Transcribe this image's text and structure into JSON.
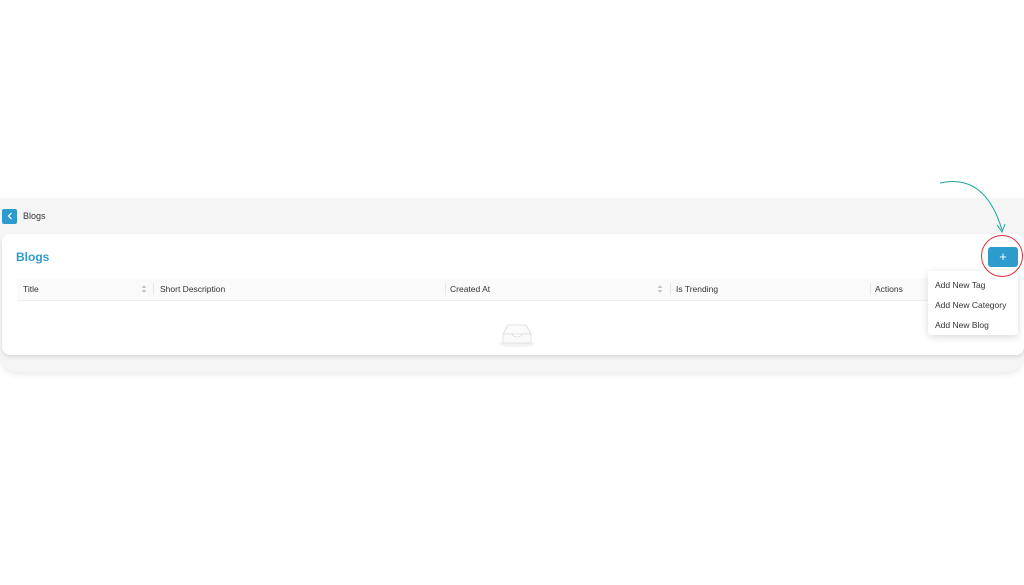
{
  "topbar": {
    "breadcrumb": "Blogs"
  },
  "card": {
    "title": "Blogs",
    "add_button_label": "+"
  },
  "table": {
    "columns": [
      "Title",
      "Short Description",
      "Created At",
      "Is Trending",
      "Actions"
    ]
  },
  "dropdown": {
    "items": [
      "Add New Tag",
      "Add New Category",
      "Add New Blog"
    ]
  },
  "colors": {
    "accent": "#2d9ccd",
    "annotation_circle": "#e0303b",
    "annotation_arrow": "#1aa89b"
  },
  "icons": {
    "back": "chevron-left-icon",
    "sort": "sort-icon",
    "empty": "empty-inbox-icon"
  }
}
